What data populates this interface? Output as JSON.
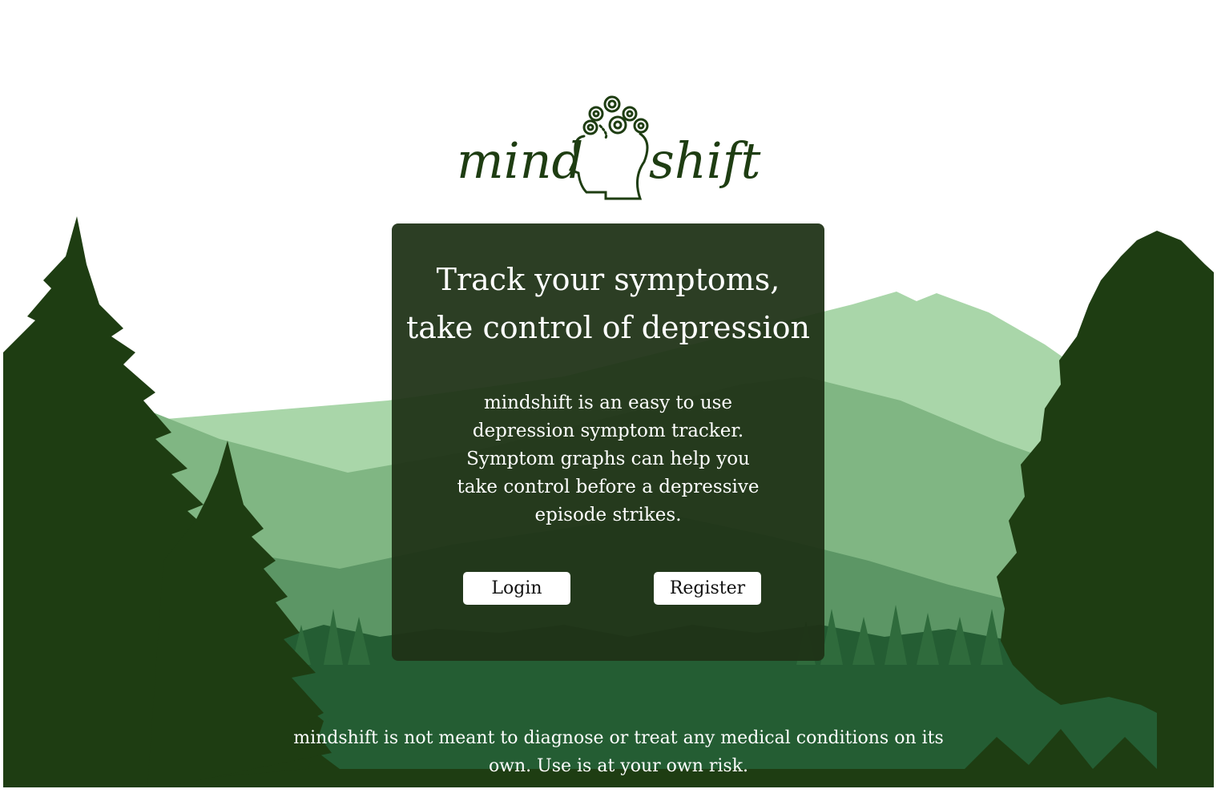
{
  "logo": {
    "left_text": "mind",
    "right_text": "shift",
    "icon": "head-spiral-icon"
  },
  "card": {
    "title_line1": "Track your symptoms,",
    "title_line2": "take control of depression",
    "description": "mindshift is an easy to use depression symptom tracker. Symptom graphs can help you take control before a depressive episode strikes.",
    "login_label": "Login",
    "register_label": "Register"
  },
  "footer": {
    "disclaimer": "mindshift is not meant to diagnose or treat any medical conditions on its own. Use is at your own risk."
  },
  "colors": {
    "dark_green": "#1e3d12",
    "forest": "#245d33",
    "mountain_light": "#a9d6a9",
    "mountain_mid": "#80b683",
    "mountain_dark": "#5c9665"
  }
}
